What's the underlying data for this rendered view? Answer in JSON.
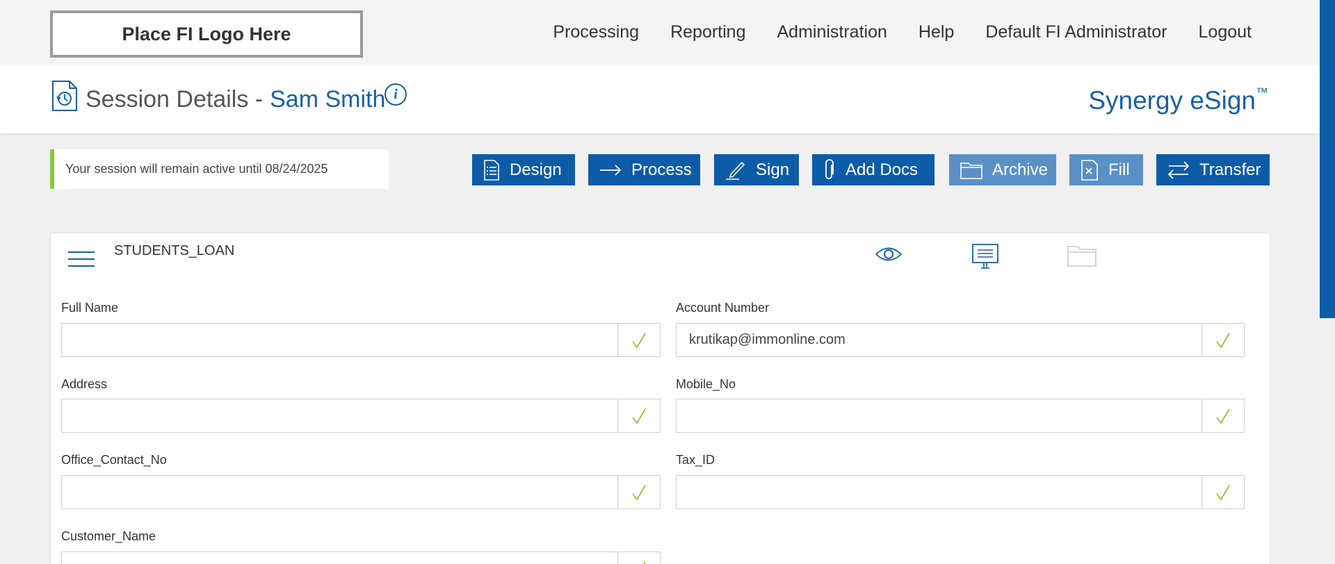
{
  "logo": {
    "text": "Place FI Logo Here"
  },
  "nav": [
    "Processing",
    "Reporting",
    "Administration",
    "Help",
    "Default FI Administrator",
    "Logout"
  ],
  "page": {
    "title_prefix": "Session Details -",
    "title_name": "Sam Smith",
    "info": "i"
  },
  "brand": {
    "name": "Synergy eSign",
    "mark": "™"
  },
  "notice": {
    "text": "Your session will remain active until 08/24/2025"
  },
  "actions": {
    "design": "Design",
    "process": "Process",
    "sign": "Sign",
    "add_docs": "Add Docs",
    "archive": "Archive",
    "fill": "Fill",
    "transfer": "Transfer"
  },
  "document": {
    "title": "STUDENTS_LOAN",
    "fields": {
      "full_name": {
        "label": "Full Name",
        "value": ""
      },
      "account_number": {
        "label": "Account Number",
        "value": "krutikap@immonline.com"
      },
      "address": {
        "label": "Address",
        "value": ""
      },
      "mobile_no": {
        "label": "Mobile_No",
        "value": ""
      },
      "office_contact_no": {
        "label": "Office_Contact_No",
        "value": ""
      },
      "tax_id": {
        "label": "Tax_ID",
        "value": ""
      },
      "customer_name": {
        "label": "Customer_Name",
        "value": ""
      }
    }
  },
  "colors": {
    "primary": "#0d5ca8",
    "primary_disabled": "#5b90c6",
    "accent_green": "#8cc63f",
    "link_blue": "#1a5fa3"
  }
}
